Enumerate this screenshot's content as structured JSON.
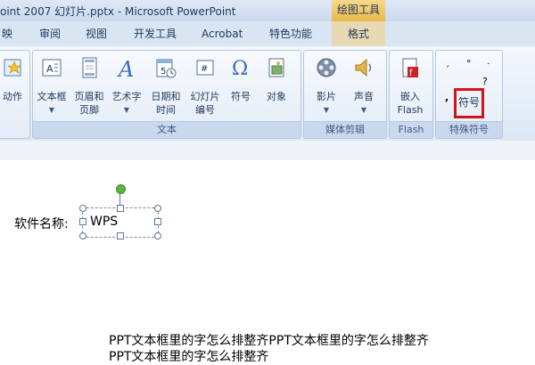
{
  "window": {
    "title": "oint 2007 幻灯片.pptx - Microsoft PowerPoint",
    "context_tab_group": "绘图工具"
  },
  "tabs": [
    {
      "label": "映"
    },
    {
      "label": "审阅"
    },
    {
      "label": "视图"
    },
    {
      "label": "开发工具"
    },
    {
      "label": "Acrobat"
    },
    {
      "label": "特色功能"
    },
    {
      "label": "格式"
    }
  ],
  "ribbon": {
    "groups": {
      "partial": {
        "button": "动作"
      },
      "text": {
        "label": "文本",
        "buttons": [
          {
            "label": "文本框",
            "icon": "textbox-icon"
          },
          {
            "label": "页眉和\n页脚",
            "icon": "header-footer-icon"
          },
          {
            "label": "艺术字",
            "icon": "wordart-icon"
          },
          {
            "label": "日期和\n时间",
            "icon": "calendar-icon"
          },
          {
            "label": "幻灯片\n编号",
            "icon": "slide-number-icon"
          },
          {
            "label": "符号",
            "icon": "omega-icon"
          },
          {
            "label": "对象",
            "icon": "object-icon"
          }
        ]
      },
      "media": {
        "label": "媒体剪辑",
        "buttons": [
          {
            "label": "影片",
            "icon": "film-reel-icon"
          },
          {
            "label": "声音",
            "icon": "speaker-icon"
          }
        ]
      },
      "flash": {
        "label": "Flash",
        "buttons": [
          {
            "label": "嵌入\nFlash",
            "icon": "flash-icon"
          }
        ]
      },
      "special": {
        "label": "特殊符号",
        "symbols_button": "符号",
        "symbol_glyphs": [
          "ˏ",
          "°",
          "˙",
          "?",
          ","
        ]
      }
    }
  },
  "slide": {
    "label": "软件名称:",
    "textbox_value": "WPS",
    "body_line1": "PPT文本框里的字怎么排整齐PPT文本框里的字怎么排整齐",
    "body_line2": "PPT文本框里的字怎么排整齐"
  },
  "colors": {
    "highlight_box": "#d0141c",
    "rotate_handle": "#5bb53a"
  }
}
